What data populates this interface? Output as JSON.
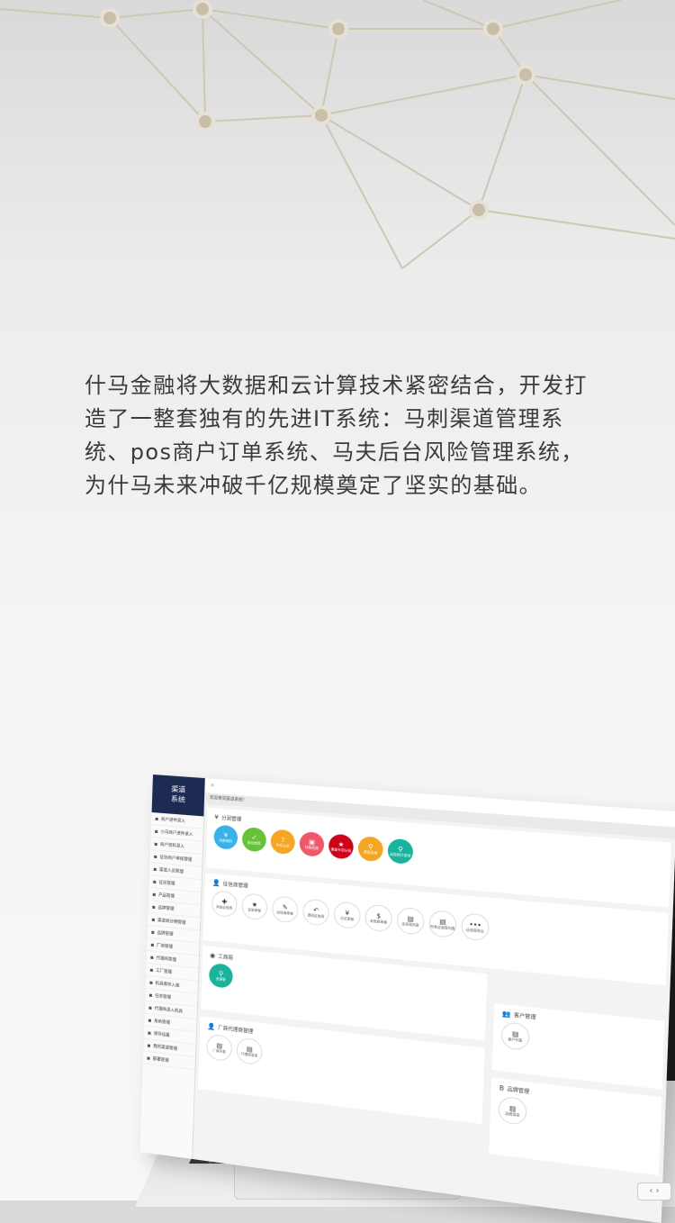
{
  "intro": {
    "text": "什马金融将大数据和云计算技术紧密结合，开发打造了一整套独有的先进IT系统：马刺渠道管理系统、pos商户订单系统、马夫后台风险管理系统，为什马未来冲破千亿规模奠定了坚实的基础。"
  },
  "screen": {
    "logo_line1": "渠道",
    "logo_line2": "系统",
    "topbar_close": "×",
    "welcome": "欢迎来到渠道系统！",
    "sidebar_items": [
      "商户进件录入",
      "小马商户进件录入",
      "商户资料录入",
      "征信商户审核管理",
      "渠道人员管理",
      "征信管理",
      "产品管理",
      "品牌管理",
      "渠道商分佣管理",
      "品牌管理",
      "厂商管理",
      "代理商管理",
      "工厂管理",
      "机具库存入库",
      "任务管理",
      "代理商录入机具",
      "角色管理",
      "领导设置",
      "我的渠道管理",
      "部署管理"
    ],
    "panel1": {
      "title": "分润管理",
      "icon": "¥",
      "buttons": [
        {
          "label": "收费规则",
          "icon": "¥",
          "color": "#3ab1e8"
        },
        {
          "label": "自动结算",
          "icon": "✓",
          "color": "#67c23a"
        },
        {
          "label": "实名认证",
          "icon": "⇧",
          "color": "#f5a623"
        },
        {
          "label": "特殊结算",
          "icon": "▣",
          "color": "#f0576b"
        },
        {
          "label": "渠道专项分润",
          "icon": "★",
          "color": "#d0021b"
        },
        {
          "label": "提现查询",
          "icon": "⚲",
          "color": "#f5a623"
        },
        {
          "label": "返现统计查询",
          "icon": "⚲",
          "color": "#19b49b"
        }
      ]
    },
    "panel2": {
      "title": "征信商管理",
      "icon": "👤",
      "buttons": [
        {
          "label": "添加征信商",
          "icon": "✚"
        },
        {
          "label": "征信审核",
          "icon": "★"
        },
        {
          "label": "征信商审核",
          "icon": "✎"
        },
        {
          "label": "退回征信商",
          "icon": "↶"
        },
        {
          "label": "日记审核",
          "icon": "¥"
        },
        {
          "label": "未批款审核",
          "icon": "$"
        },
        {
          "label": "征信商列表",
          "icon": "▤"
        },
        {
          "label": "所有征信商列表",
          "icon": "▤"
        },
        {
          "label": "征信商导出",
          "icon": "•••"
        }
      ]
    },
    "panel3": {
      "title": "工商局",
      "icon": "◉",
      "buttons": [
        {
          "label": "资源管",
          "icon": "⚲",
          "color": "#19b49b"
        }
      ]
    },
    "panel4": {
      "title": "客户管理",
      "icon": "👥",
      "buttons": [
        {
          "label": "客户列表",
          "icon": "▤"
        }
      ]
    },
    "panel5": {
      "title": "厂商代理商管理",
      "icon": "👤",
      "buttons": [
        {
          "label": "厂商列表",
          "icon": "▤"
        },
        {
          "label": "代理商追录",
          "icon": "▤"
        }
      ]
    },
    "panel6": {
      "title": "品牌管理",
      "icon": "B",
      "buttons": [
        {
          "label": "品牌追录",
          "icon": "▤"
        }
      ]
    }
  },
  "page_nav": {
    "arrows": "‹ ›"
  }
}
